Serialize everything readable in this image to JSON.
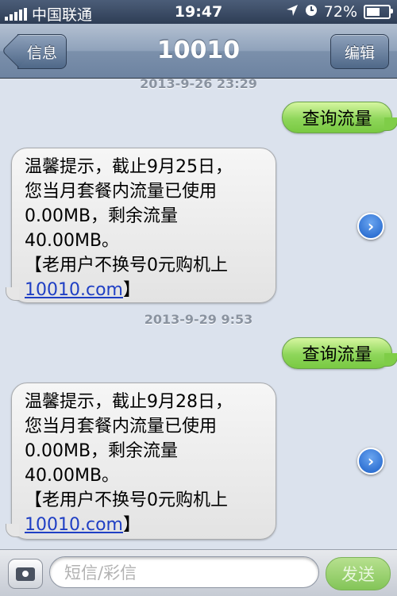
{
  "status_bar": {
    "carrier": "中国联通",
    "time": "19:47",
    "battery": "72%",
    "battery_level": 0.72
  },
  "nav": {
    "back_label": "信息",
    "title": "10010",
    "edit_label": "编辑"
  },
  "messages": [
    {
      "timestamp": "2013-9-26 23:29",
      "sent": "查询流量",
      "reply_lines": [
        "温馨提示，截止9月25日，",
        "您当月套餐内流量已使用",
        "0.00MB，剩余流量",
        "40.00MB。",
        "【老用户不换号0元购机上"
      ],
      "link": "10010.com",
      "link_tail": "】"
    },
    {
      "timestamp": "2013-9-29 9:53",
      "sent": "查询流量",
      "reply_lines": [
        "温馨提示，截止9月28日，",
        "您当月套餐内流量已使用",
        "0.00MB，剩余流量",
        "40.00MB。",
        "【老用户不换号0元购机上"
      ],
      "link": "10010.com",
      "link_tail": "】"
    }
  ],
  "composer": {
    "placeholder": "短信/彩信",
    "send_label": "发送"
  },
  "icons": {
    "signal": "signal-bars-icon",
    "location": "location-arrow-icon",
    "alarm": "clock-icon",
    "battery": "battery-icon",
    "camera": "camera-icon",
    "disclosure": "disclosure-chevron-icon"
  }
}
